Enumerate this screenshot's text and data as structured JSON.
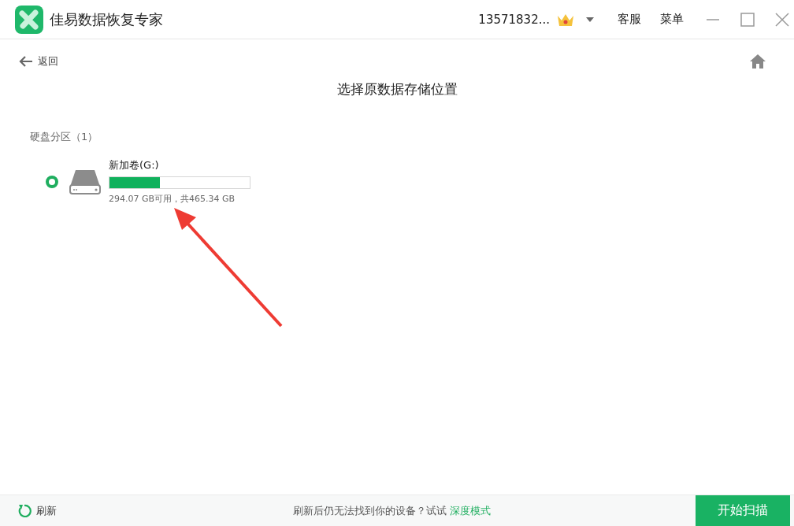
{
  "window": {
    "title": "佳易数据恢复专家",
    "account": "13571832...",
    "menu_items": [
      "客服",
      "菜单"
    ]
  },
  "nav": {
    "back": "返回"
  },
  "page_title": "选择原数据存储位置",
  "section": {
    "title": "硬盘分区（1）",
    "drives": [
      {
        "name": "新加卷(G:)",
        "selected": true,
        "level": 0.36,
        "info": "294.07 GB可用，共465.34 GB"
      }
    ]
  },
  "footer": {
    "refresh": "刷新",
    "hint": "刷新后仍无法找到你的设备？试试",
    "link": "深度模式",
    "scan_button": "开始扫描"
  }
}
